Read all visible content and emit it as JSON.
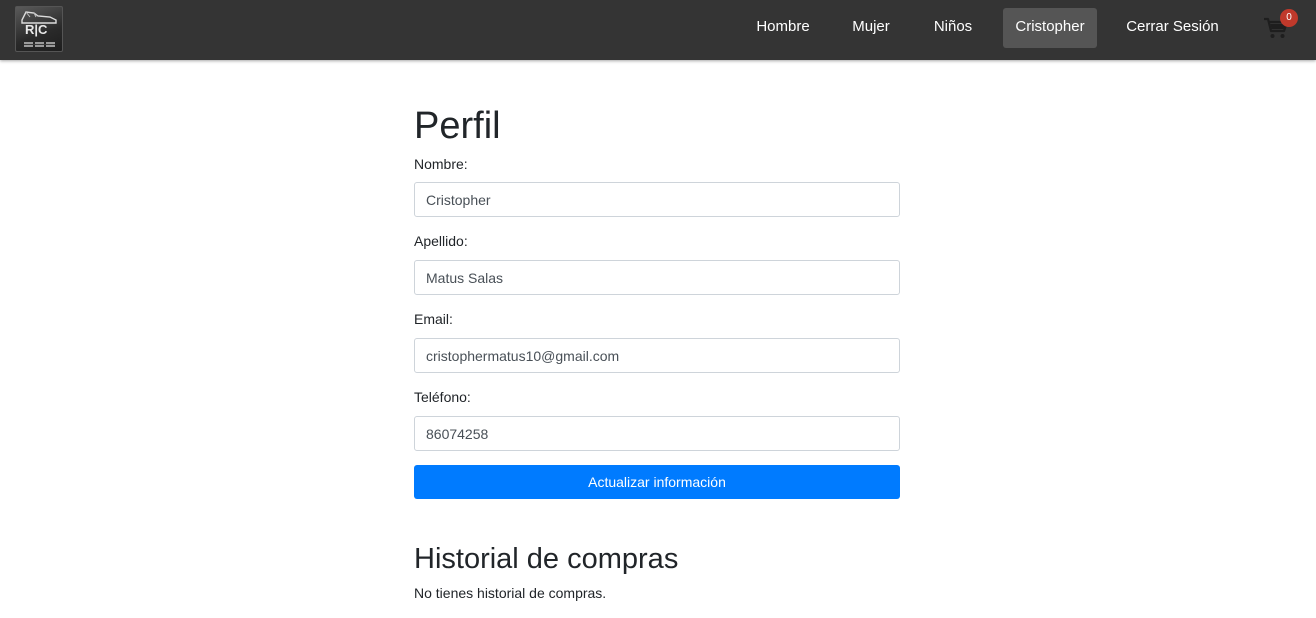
{
  "logo": {
    "text": "R|C",
    "icon": "shoe-logo"
  },
  "nav": {
    "items": [
      {
        "label": "Hombre"
      },
      {
        "label": "Mujer"
      },
      {
        "label": "Niños"
      },
      {
        "label": "Cristopher",
        "active": true
      },
      {
        "label": "Cerrar Sesión"
      }
    ],
    "cart": {
      "icon": "cart-icon",
      "count": "0"
    }
  },
  "profile": {
    "title": "Perfil",
    "fields": [
      {
        "label": "Nombre:",
        "value": "Cristopher"
      },
      {
        "label": "Apellido:",
        "value": "Matus Salas"
      },
      {
        "label": "Email:",
        "value": "cristophermatus10@gmail.com"
      },
      {
        "label": "Teléfono:",
        "value": "86074258"
      }
    ],
    "submit_label": "Actualizar información"
  },
  "history": {
    "title": "Historial de compras",
    "empty_text": "No tienes historial de compras."
  },
  "colors": {
    "navbar": "#343434",
    "active_nav": "#555555",
    "primary_button": "#007bff",
    "cart_badge": "#c0392b"
  }
}
